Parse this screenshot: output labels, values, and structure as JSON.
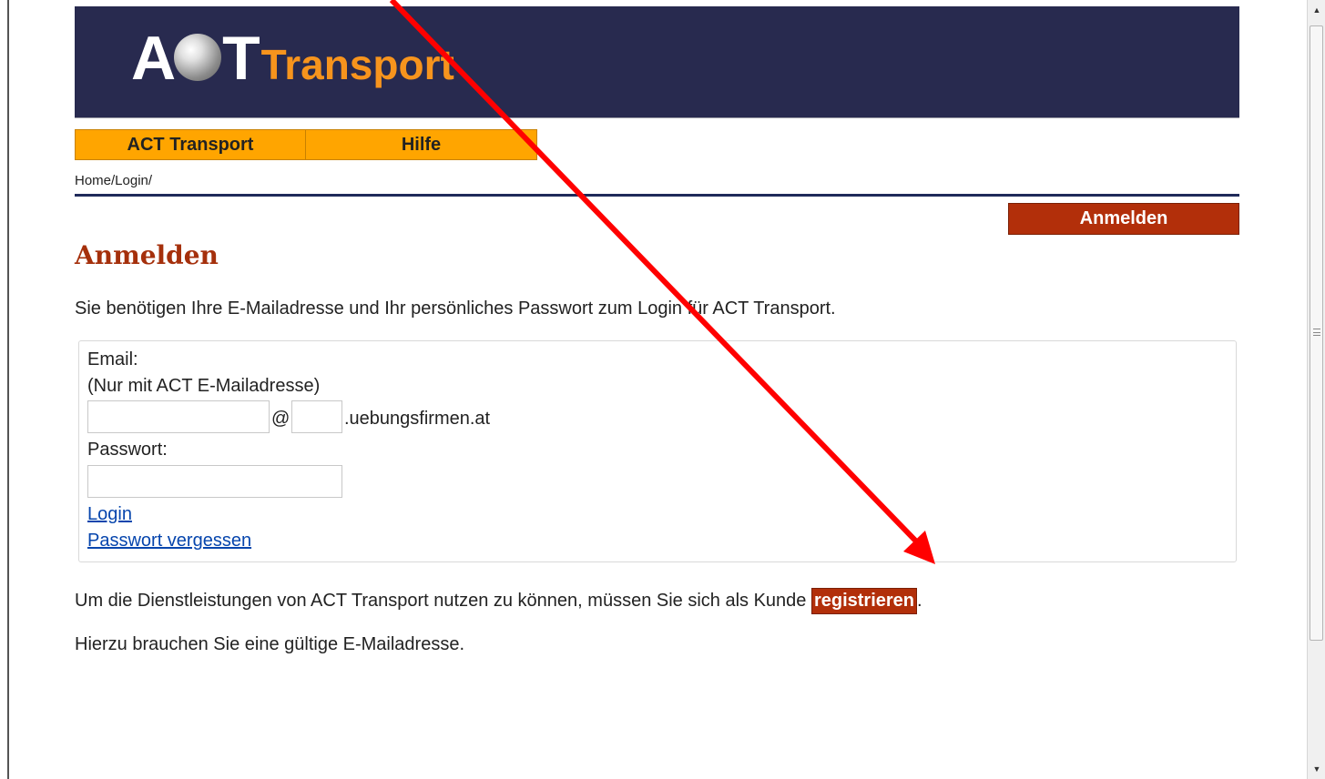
{
  "header": {
    "logo_main": "ACT",
    "logo_sub": "Transport"
  },
  "nav": {
    "tabs": [
      {
        "label": "ACT Transport"
      },
      {
        "label": "Hilfe"
      }
    ]
  },
  "breadcrumb": "Home/Login/",
  "sidebar_button": {
    "label": "Anmelden"
  },
  "page": {
    "title": "Anmelden",
    "intro": "Sie benötigen Ihre E-Mailadresse und Ihr persönliches Passwort zum Login für ACT Transport."
  },
  "login_form": {
    "email_label": "Email:",
    "email_hint": "(Nur mit ACT E-Mailadresse)",
    "email_user_value": "",
    "at_sign": "@",
    "email_domain_value": "",
    "domain_suffix": ".uebungsfirmen.at",
    "password_label": "Passwort:",
    "password_value": "",
    "login_link": "Login",
    "forgot_link": "Passwort vergessen"
  },
  "register": {
    "text_before": "Um die Dienstleistungen von ACT Transport nutzen zu können, müssen Sie sich als Kunde ",
    "badge": "registrieren",
    "text_after": "."
  },
  "note": "Hierzu brauchen Sie eine gültige E-Mailadresse.",
  "colors": {
    "banner": "#282a4f",
    "nav_orange": "#ffa500",
    "accent_red": "#b22f0a",
    "title_red": "#a5300c",
    "arrow_red": "#ff0000",
    "logo_orange": "#f7941d",
    "link_blue": "#0645ad"
  },
  "icons": {
    "scroll_up": "up-arrow-icon",
    "scroll_down": "down-arrow-icon",
    "annotation": "red-arrow-annotation"
  }
}
